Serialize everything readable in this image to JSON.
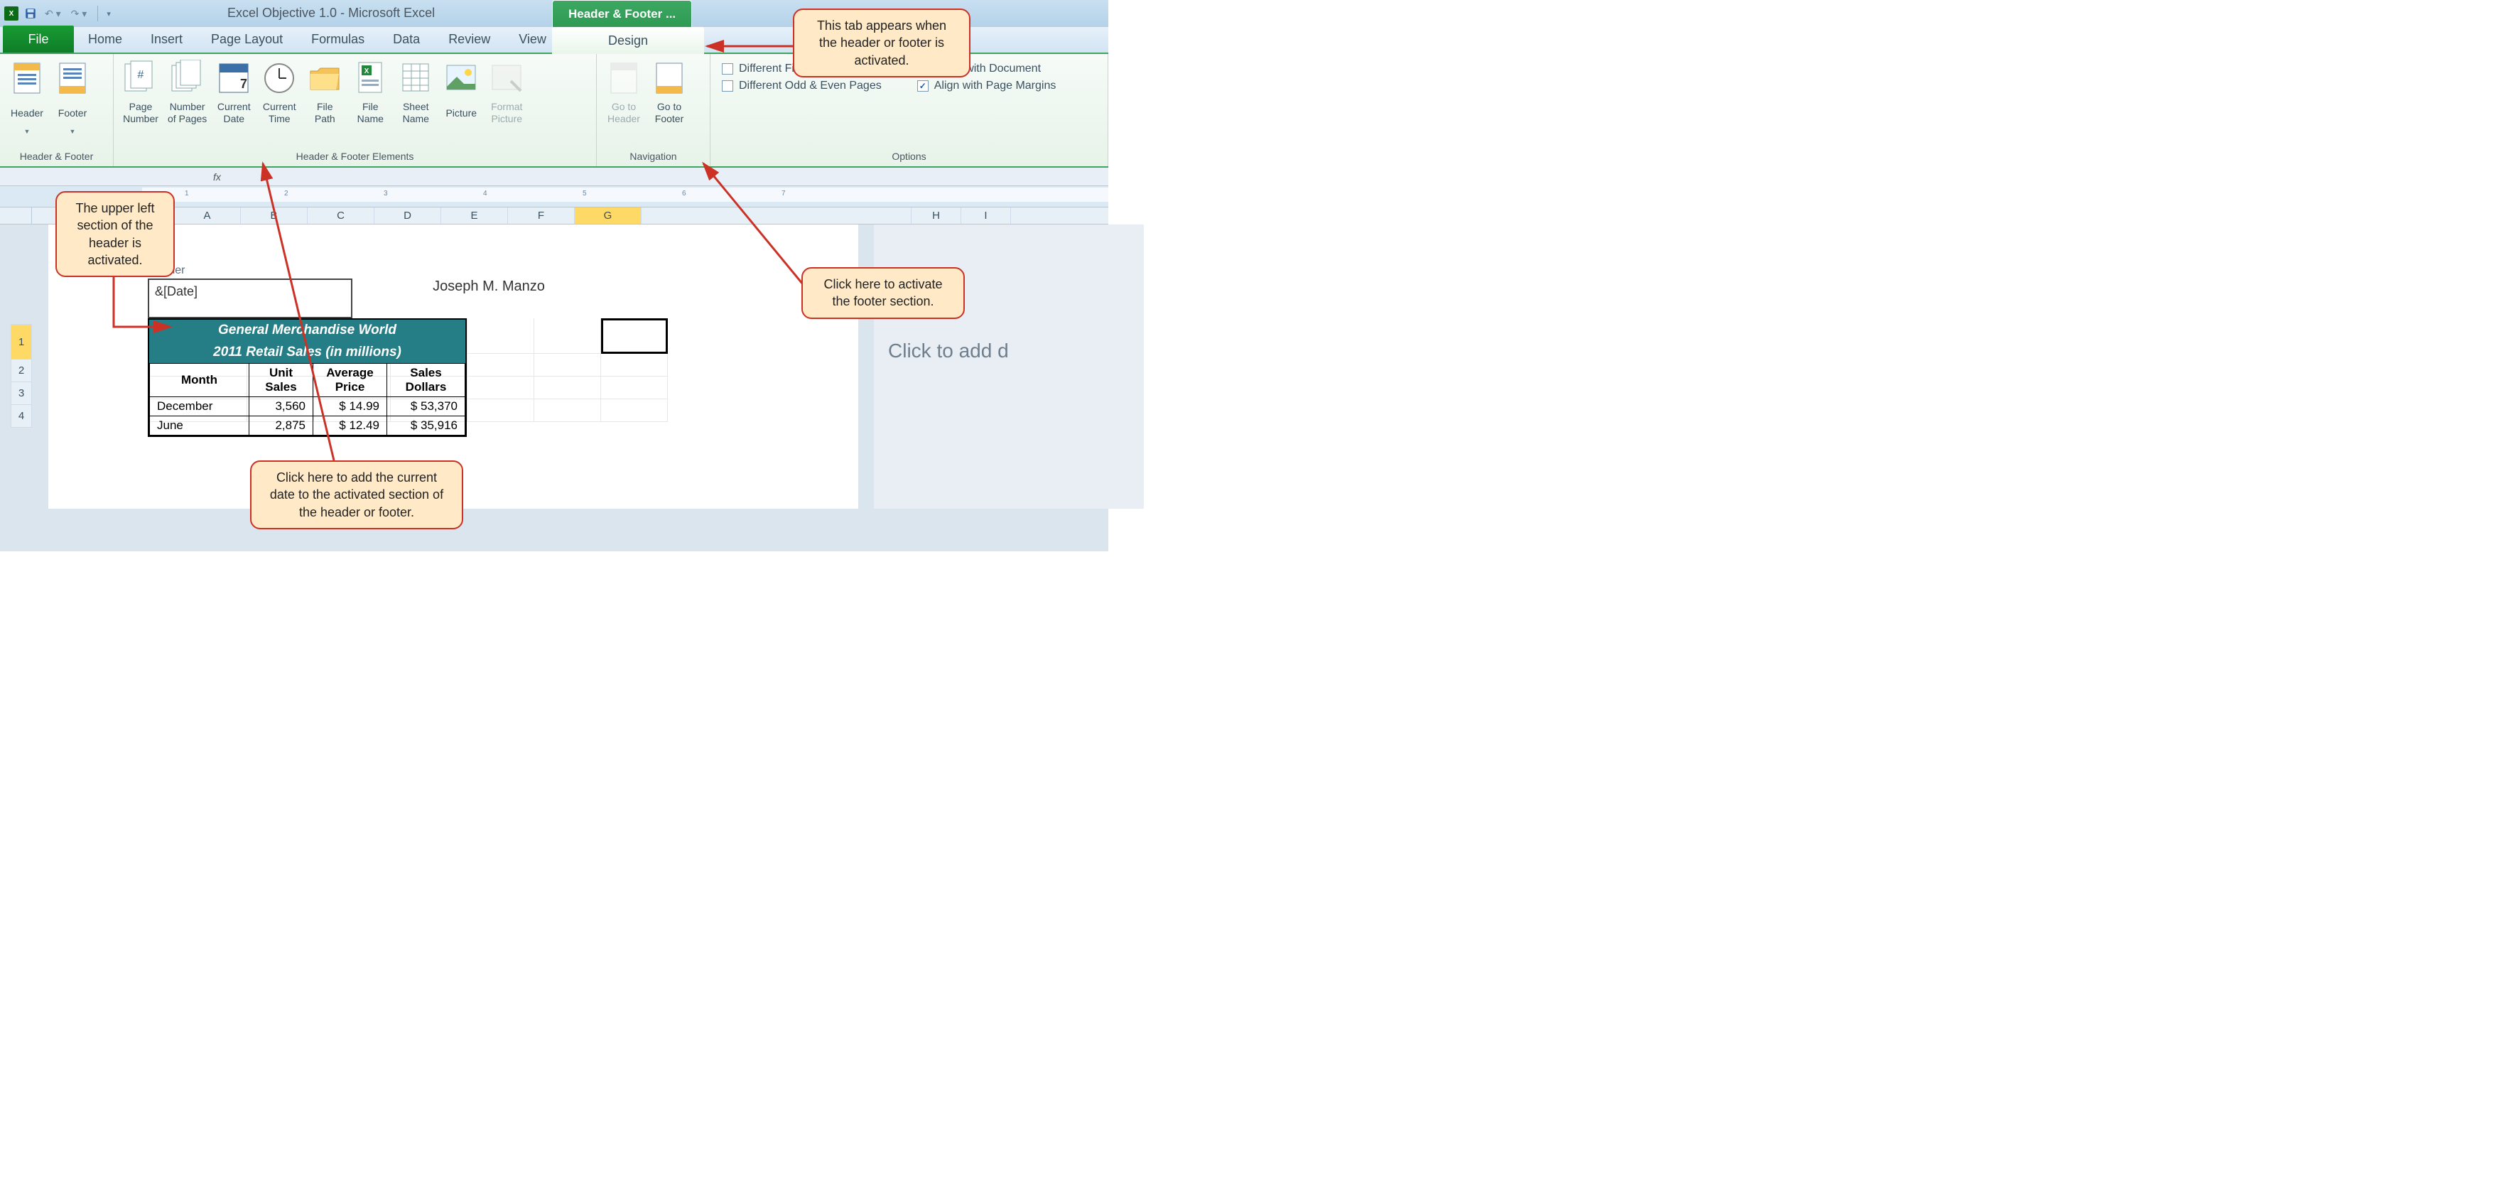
{
  "titlebar": {
    "app_icon_text": "X",
    "title": "Excel Objective 1.0  -  Microsoft Excel",
    "contextual_tab": "Header & Footer ..."
  },
  "tabs": {
    "file": "File",
    "items": [
      "Home",
      "Insert",
      "Page Layout",
      "Formulas",
      "Data",
      "Review",
      "View"
    ],
    "design": "Design"
  },
  "ribbon": {
    "group_hf": {
      "label": "Header & Footer",
      "header": "Header",
      "footer": "Footer"
    },
    "group_elements": {
      "label": "Header & Footer Elements",
      "page_number": "Page\nNumber",
      "number_of_pages": "Number\nof Pages",
      "current_date": "Current\nDate",
      "current_time": "Current\nTime",
      "file_path": "File\nPath",
      "file_name": "File\nName",
      "sheet_name": "Sheet\nName",
      "picture": "Picture",
      "format_picture": "Format\nPicture"
    },
    "group_nav": {
      "label": "Navigation",
      "goto_header": "Go to\nHeader",
      "goto_footer": "Go to\nFooter"
    },
    "group_opts": {
      "label": "Options",
      "diff_first": "Different First Page",
      "diff_oddeven": "Different Odd & Even Pages",
      "scale": "Scale with Document",
      "align": "Align with Page Margins"
    }
  },
  "fx_label": "fx",
  "ruler_numbers": [
    "1",
    "2",
    "3",
    "4",
    "5",
    "6",
    "7"
  ],
  "columns": [
    "A",
    "B",
    "C",
    "D",
    "E",
    "F",
    "G",
    "H",
    "I"
  ],
  "rows": [
    "1",
    "2",
    "3",
    "4"
  ],
  "header_area": {
    "label": "Header",
    "left_value": "&[Date]",
    "center_value": "Joseph M. Manzo"
  },
  "right_page_prompt": "Click to add d",
  "chart_data": {
    "type": "table",
    "title_line1": "General Merchandise World",
    "title_line2": "2011 Retail Sales (in millions)",
    "columns": [
      "Month",
      "Unit Sales",
      "Average Price",
      "Sales Dollars"
    ],
    "rows": [
      {
        "month": "December",
        "unit_sales": "3,560",
        "avg_price": "$   14.99",
        "sales_dollars": "$     53,370"
      },
      {
        "month": "June",
        "unit_sales": "2,875",
        "avg_price": "$   12.49",
        "sales_dollars": "$     35,916"
      }
    ]
  },
  "callouts": {
    "c1": "This tab appears when the header or footer is activated.",
    "c2": "The upper left section of the header is activated.",
    "c3": "Click here to activate the footer section.",
    "c4": "Click here to add the current date to the activated section of the header or footer."
  }
}
